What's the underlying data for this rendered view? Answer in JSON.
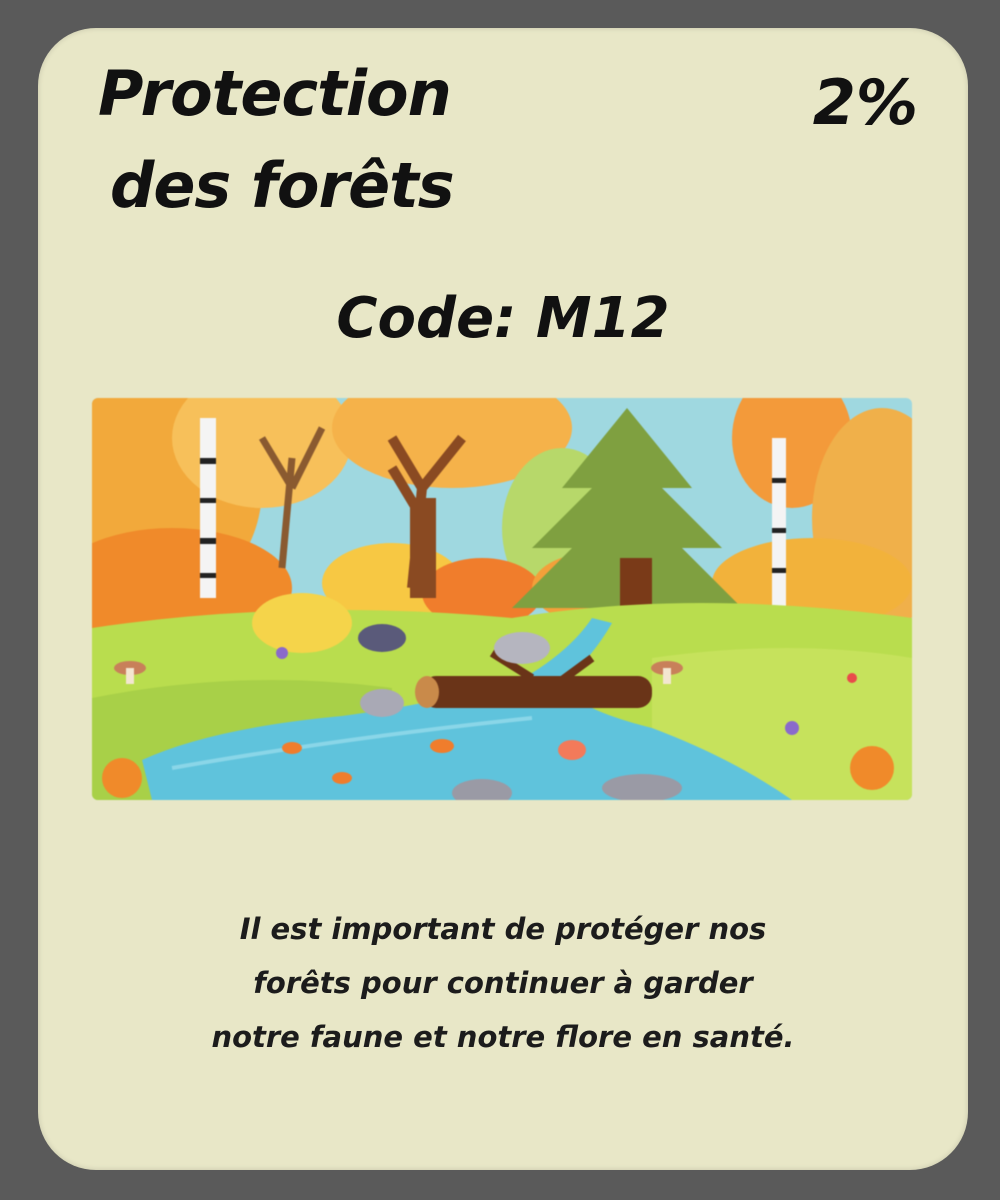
{
  "card": {
    "title_line1": "Protection",
    "title_line2": "des forêts",
    "percent": "2%",
    "code": "Code: M12",
    "description_lines": [
      "Il est important de protéger nos",
      "forêts pour continuer à garder",
      "notre faune et notre flore en santé."
    ]
  },
  "colors": {
    "card_background": "#e8e7c7",
    "page_background": "#5a5a5a",
    "text": "#111111"
  }
}
